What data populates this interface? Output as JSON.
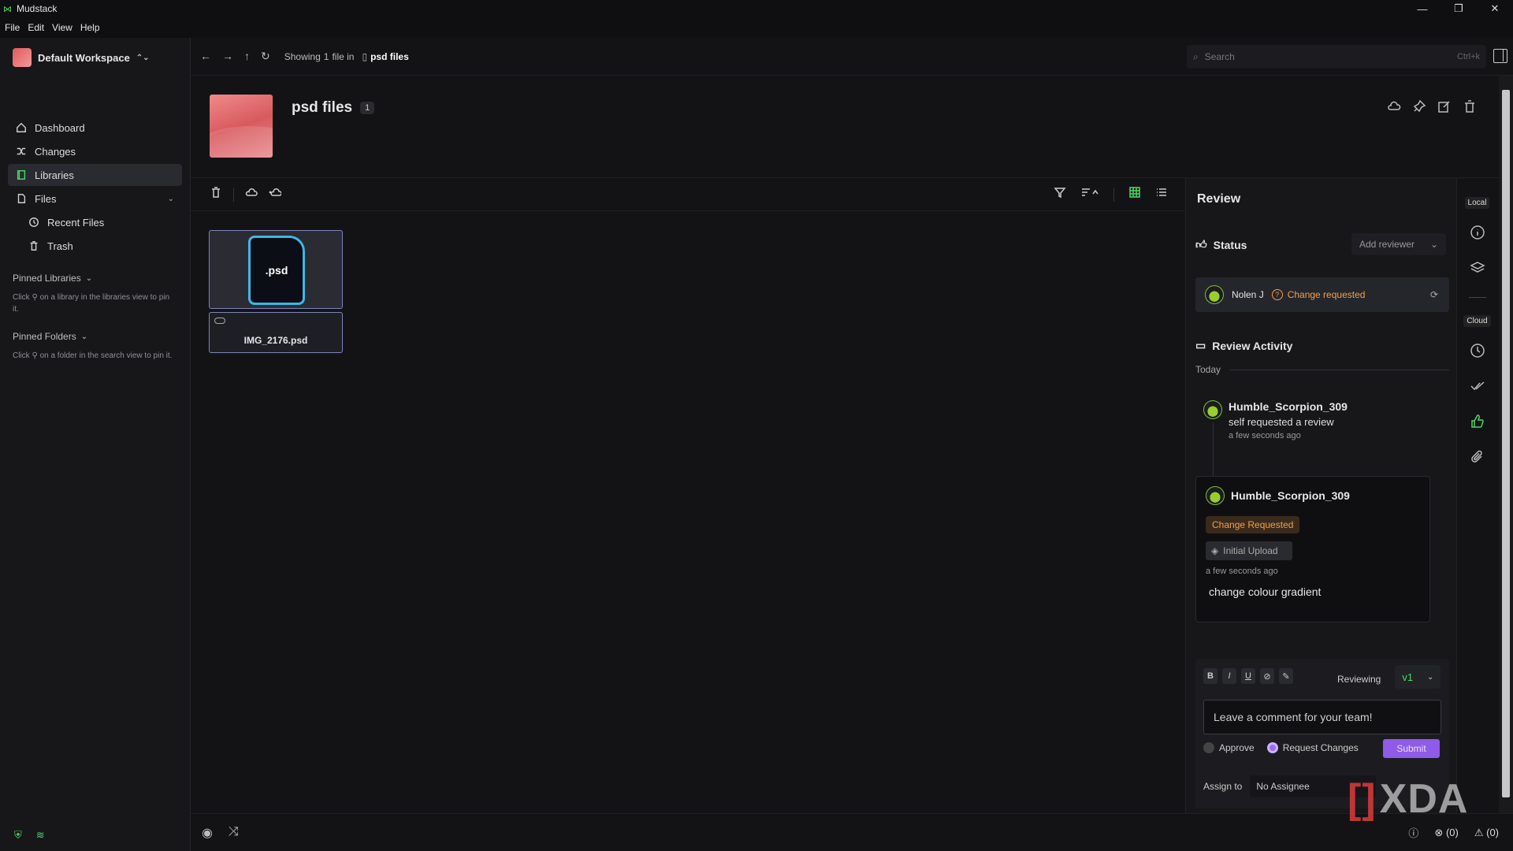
{
  "window": {
    "title": "Mudstack",
    "controls": [
      "—",
      "❐",
      "✕"
    ]
  },
  "menu": [
    "File",
    "Edit",
    "View",
    "Help"
  ],
  "sidebar": {
    "workspace": "Default Workspace",
    "items": [
      {
        "label": "Dashboard",
        "icon": "home-icon"
      },
      {
        "label": "Changes",
        "icon": "shuffle-icon"
      },
      {
        "label": "Libraries",
        "icon": "book-icon"
      },
      {
        "label": "Files",
        "icon": "file-icon"
      },
      {
        "label": "Recent Files",
        "icon": "history-icon"
      },
      {
        "label": "Trash",
        "icon": "trash-icon"
      }
    ],
    "pinned_libraries": {
      "title": "Pinned Libraries",
      "pre": "Click",
      "post": "on a library in the libraries view to pin it."
    },
    "pinned_folders": {
      "title": "Pinned Folders",
      "pre": "Click",
      "post": "on a folder in the search view to pin it."
    }
  },
  "topbar": {
    "showing_pre": "Showing",
    "showing_count": "1",
    "showing_post": "file in",
    "folder": "psd files",
    "search_placeholder": "Search",
    "search_shortcut": "Ctrl+k"
  },
  "library": {
    "title": "psd files",
    "count": "1"
  },
  "file": {
    "ext": ".psd",
    "name": "IMG_2176.psd"
  },
  "review": {
    "title": "Review",
    "status_label": "Status",
    "add_reviewer": "Add reviewer",
    "reviewer": {
      "name": "Nolen J",
      "status": "Change requested"
    },
    "activity_label": "Review Activity",
    "today": "Today",
    "event1": {
      "user": "Humble_Scorpion_309",
      "text": "self requested a review",
      "time": "a few seconds ago"
    },
    "event2": {
      "user": "Humble_Scorpion_309",
      "badge": "Change Requested",
      "version": "Initial Upload",
      "time": "a few seconds ago",
      "comment": "change colour gradient"
    },
    "composer": {
      "format_buttons": [
        "B",
        "I",
        "U",
        "⊘",
        "✎"
      ],
      "reviewing_label": "Reviewing",
      "version": "v1",
      "placeholder": "Leave a comment for your team!",
      "approve": "Approve",
      "request_changes": "Request Changes",
      "submit": "Submit",
      "assign_label": "Assign to",
      "assignee": "No Assignee"
    }
  },
  "rail": {
    "local": "Local",
    "cloud": "Cloud"
  },
  "statusbar": {
    "errors": "(0)",
    "warnings": "(0)"
  },
  "watermark": "XDA",
  "colors": {
    "accent_green": "#4cd964",
    "change_requested": "#f0a04b",
    "submit_purple": "#8f5be8",
    "file_border": "#3fb6e8"
  }
}
